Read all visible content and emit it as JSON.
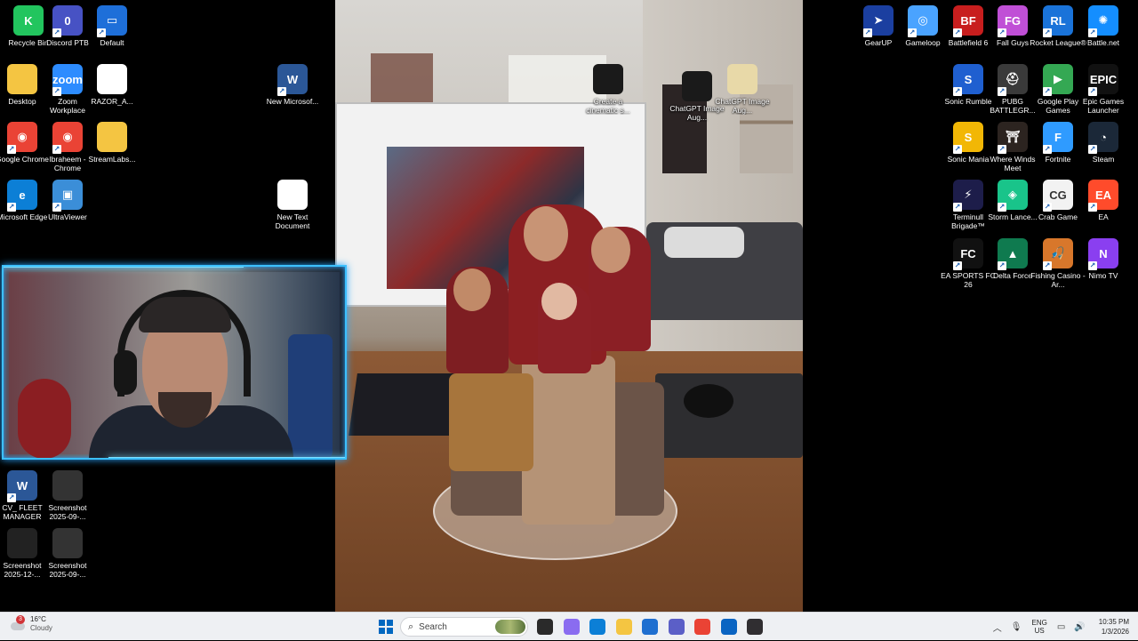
{
  "desktop": {
    "icons_left": [
      {
        "label": "Recycle Bin",
        "icon": "recycle-bin-icon",
        "color": "#22c55e",
        "glyph": "K"
      },
      {
        "label": "Discord PTB",
        "icon": "discord-icon",
        "color": "#4752c4",
        "glyph": "0"
      },
      {
        "label": "Default",
        "icon": "monitor-icon",
        "color": "#1e6fd9",
        "glyph": "▭"
      },
      {
        "label": "Desktop",
        "icon": "folder-icon",
        "color": "#f4c542",
        "glyph": ""
      },
      {
        "label": "Zoom Workplace",
        "icon": "zoom-icon",
        "color": "#2d8cff",
        "glyph": "zoom"
      },
      {
        "label": "RAZOR_A...",
        "icon": "document-icon",
        "color": "#ffffff",
        "glyph": ""
      },
      {
        "label": "Google Chrome",
        "icon": "chrome-icon",
        "color": "#ea4335",
        "glyph": "◉"
      },
      {
        "label": "Ibraheem - Chrome",
        "icon": "chrome-profile-icon",
        "color": "#ea4335",
        "glyph": "◉"
      },
      {
        "label": "StreamLabs...",
        "icon": "folder-icon",
        "color": "#f4c542",
        "glyph": ""
      },
      {
        "label": "Microsoft Edge",
        "icon": "edge-icon",
        "color": "#0c7fd6",
        "glyph": "e"
      },
      {
        "label": "UltraViewer",
        "icon": "ultraviewer-icon",
        "color": "#3b8ed8",
        "glyph": "▣"
      },
      {
        "label": "CV_ FLEET MANAGER",
        "icon": "word-icon",
        "color": "#2b5797",
        "glyph": "W"
      },
      {
        "label": "Screenshot 2025-09-...",
        "icon": "screenshot-icon",
        "color": "#333333",
        "glyph": ""
      },
      {
        "label": "Screenshot 2025-12-...",
        "icon": "screenshot-icon",
        "color": "#222222",
        "glyph": ""
      },
      {
        "label": "Screenshot 2025-09-...",
        "icon": "screenshot-icon",
        "color": "#333333",
        "glyph": ""
      }
    ],
    "icons_middle": [
      {
        "label": "New Microsof...",
        "icon": "word-icon",
        "color": "#2b5797",
        "glyph": "W"
      },
      {
        "label": "New Text Document",
        "icon": "text-document-icon",
        "color": "#ffffff",
        "glyph": ""
      },
      {
        "label": "Create a cinematic s...",
        "icon": "image-file-icon",
        "color": "#1a1a1a",
        "glyph": ""
      },
      {
        "label": "ChatGPT Image Aug...",
        "icon": "image-file-icon",
        "color": "#1a1a1a",
        "glyph": ""
      },
      {
        "label": "ChatGPT Image Aug...",
        "icon": "image-file-icon",
        "color": "#e8d9a8",
        "glyph": ""
      }
    ],
    "icons_right": [
      {
        "label": "GearUP",
        "icon": "gearup-icon",
        "color": "#1b3fa0",
        "glyph": "➤"
      },
      {
        "label": "Gameloop",
        "icon": "gameloop-icon",
        "color": "#4aa3ff",
        "glyph": "◎"
      },
      {
        "label": "Battlefield 6",
        "icon": "battlefield-icon",
        "color": "#c81e1e",
        "glyph": "BF"
      },
      {
        "label": "Fall Guys",
        "icon": "fallguys-icon",
        "color": "#c04fd6",
        "glyph": "FG"
      },
      {
        "label": "Rocket League®",
        "icon": "rocket-league-icon",
        "color": "#1a73d9",
        "glyph": "RL"
      },
      {
        "label": "Battle.net",
        "icon": "battlenet-icon",
        "color": "#148eff",
        "glyph": "✺"
      },
      {
        "label": "Sonic Rumble",
        "icon": "sonic-icon",
        "color": "#1f5fd0",
        "glyph": "S"
      },
      {
        "label": "PUBG BATTLEGR...",
        "icon": "pubg-icon",
        "color": "#3a3a3a",
        "glyph": "⛑"
      },
      {
        "label": "Google Play Games",
        "icon": "google-play-icon",
        "color": "#34a853",
        "glyph": "▶"
      },
      {
        "label": "Epic Games Launcher",
        "icon": "epic-games-icon",
        "color": "#111111",
        "glyph": "EPIC"
      },
      {
        "label": "Sonic Mania",
        "icon": "sonic-mania-icon",
        "color": "#f2b705",
        "glyph": "S"
      },
      {
        "label": "Where Winds Meet",
        "icon": "where-winds-meet-icon",
        "color": "#2c2420",
        "glyph": "⛩"
      },
      {
        "label": "Fortnite",
        "icon": "fortnite-icon",
        "color": "#2f9bff",
        "glyph": "F"
      },
      {
        "label": "Steam",
        "icon": "steam-icon",
        "color": "#1b2838",
        "glyph": "◔"
      },
      {
        "label": "Terminull Brigade™",
        "icon": "terminull-icon",
        "color": "#1d1d4a",
        "glyph": "⚡"
      },
      {
        "label": "Storm Lance...",
        "icon": "storm-lance-icon",
        "color": "#19c48a",
        "glyph": "◈"
      },
      {
        "label": "Crab Game",
        "icon": "crab-game-icon",
        "color": "#f2f2f2",
        "glyph": "CG"
      },
      {
        "label": "EA",
        "icon": "ea-icon",
        "color": "#ff4b2b",
        "glyph": "EA"
      },
      {
        "label": "EA SPORTS FC 26",
        "icon": "fc26-icon",
        "color": "#111111",
        "glyph": "FC"
      },
      {
        "label": "Delta Force",
        "icon": "delta-force-icon",
        "color": "#0f7a4f",
        "glyph": "▲"
      },
      {
        "label": "Fishing Casino - Ar...",
        "icon": "fishing-casino-icon",
        "color": "#d8772b",
        "glyph": "🎣"
      },
      {
        "label": "Nimo TV",
        "icon": "nimo-tv-icon",
        "color": "#8a3ff0",
        "glyph": "N"
      }
    ]
  },
  "taskbar": {
    "weather": {
      "temp": "16°C",
      "condition": "Cloudy",
      "badge": "3"
    },
    "search_placeholder": "Search",
    "apps": [
      {
        "icon": "task-view-icon",
        "color": "#2a2a2a"
      },
      {
        "icon": "copilot-icon",
        "color": "#8a6cf0"
      },
      {
        "icon": "edge-icon",
        "color": "#0c7fd6"
      },
      {
        "icon": "file-explorer-icon",
        "color": "#f4c542"
      },
      {
        "icon": "store-icon",
        "color": "#1f6fd0"
      },
      {
        "icon": "teams-icon",
        "color": "#5b5fc7"
      },
      {
        "icon": "chrome-icon",
        "color": "#ea4335"
      },
      {
        "icon": "outlook-icon",
        "color": "#0a64c2"
      },
      {
        "icon": "obs-icon",
        "color": "#302e31"
      }
    ],
    "language": {
      "line1": "ENG",
      "line2": "US"
    },
    "clock": {
      "time": "10:35 PM",
      "date": "1/3/2026"
    }
  }
}
